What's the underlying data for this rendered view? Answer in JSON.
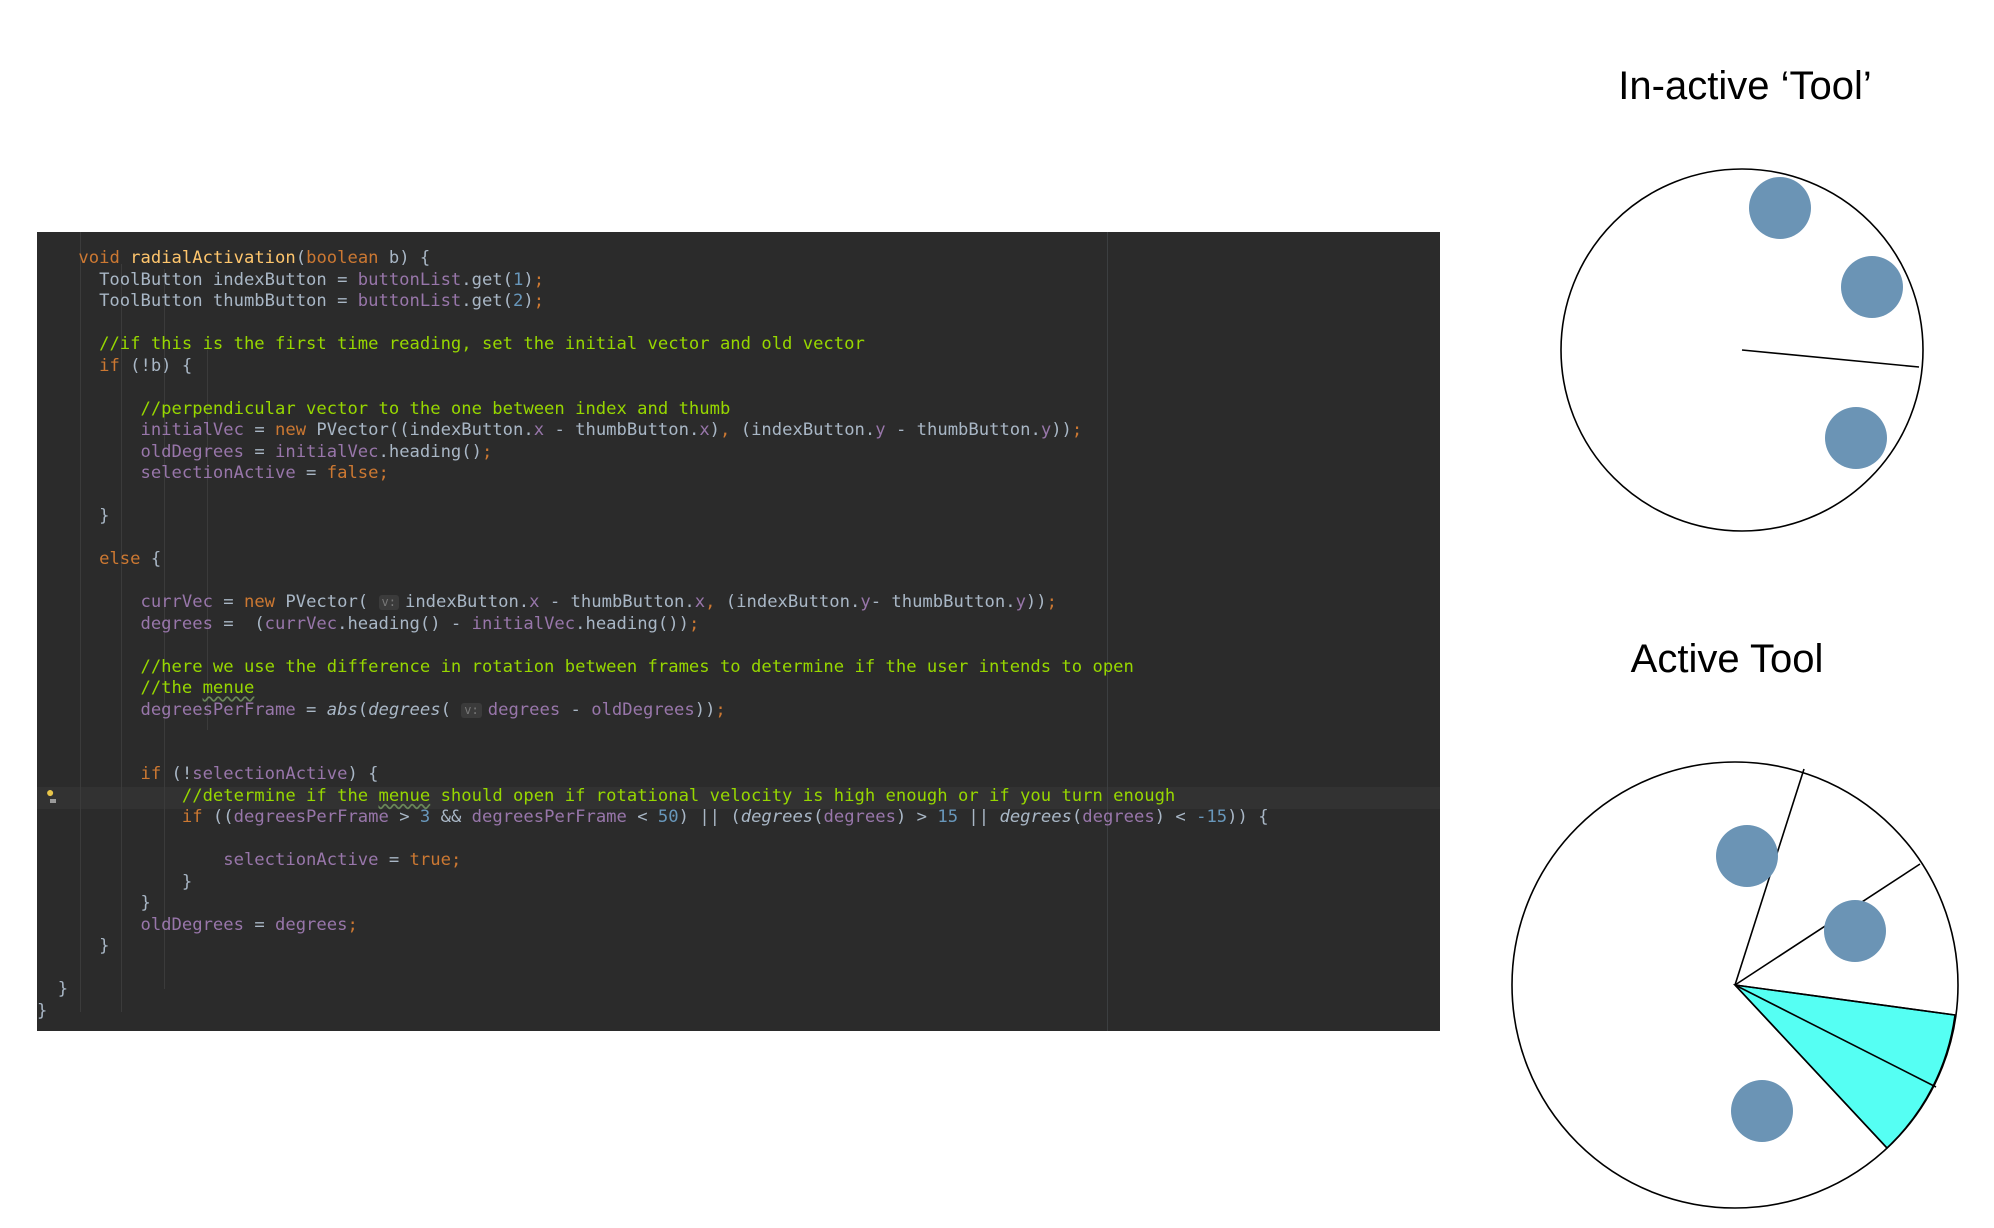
{
  "diagram": {
    "inactive_title": "In-active ‘Tool’",
    "active_title": "Active Tool"
  },
  "colors": {
    "editor_bg": "#2b2b2b",
    "button_fill": "#6b94b5",
    "active_segment": "#55fff3"
  },
  "code": {
    "lines": [
      [
        "    ",
        [
          "kw",
          "void "
        ],
        [
          "fn",
          "radialActivation"
        ],
        [
          "",
          "("
        ],
        [
          "kw",
          "boolean "
        ],
        [
          "",
          "b) {"
        ]
      ],
      [
        "      ToolButton indexButton = ",
        [
          "fld",
          "buttonList"
        ],
        [
          ".get("
        ],
        [
          "num",
          "1"
        ],
        [
          ")"
        ],
        [
          "punc",
          ";"
        ]
      ],
      [
        "      ToolButton thumbButton = ",
        [
          "fld",
          "buttonList"
        ],
        [
          ".get("
        ],
        [
          "num",
          "2"
        ],
        [
          ")"
        ],
        [
          "punc",
          ";"
        ]
      ],
      [
        ""
      ],
      [
        "      ",
        [
          "cmt",
          "//if this is the first time reading, set the initial vector and old vector"
        ]
      ],
      [
        "      ",
        [
          "kw",
          "if "
        ],
        [
          "(!b) {"
        ]
      ],
      [
        ""
      ],
      [
        "          ",
        [
          "cmt",
          "//perpendicular vector to the one between index and thumb"
        ]
      ],
      [
        "          ",
        [
          "fld",
          "initialVec"
        ],
        [
          " = "
        ],
        [
          "kw",
          "new "
        ],
        [
          "PVector((indexButton."
        ],
        [
          "fld",
          "x"
        ],
        [
          " - thumbButton."
        ],
        [
          "fld",
          "x"
        ],
        [
          ")"
        ],
        [
          "punc",
          ", "
        ],
        [
          "(indexButton."
        ],
        [
          "fld",
          "y"
        ],
        [
          " - thumbButton."
        ],
        [
          "fld",
          "y"
        ],
        [
          "))"
        ],
        [
          "punc",
          ";"
        ]
      ],
      [
        "          ",
        [
          "fld",
          "oldDegrees"
        ],
        [
          " = "
        ],
        [
          "fld",
          "initialVec"
        ],
        [
          ".heading()"
        ],
        [
          "punc",
          ";"
        ]
      ],
      [
        "          ",
        [
          "fld",
          "selectionActive"
        ],
        [
          " = "
        ],
        [
          "kw",
          "false"
        ],
        [
          "punc",
          ";"
        ]
      ],
      [
        ""
      ],
      [
        "      }"
      ],
      [
        ""
      ],
      [
        "      ",
        [
          "kw",
          "else "
        ],
        [
          "{"
        ]
      ],
      [
        ""
      ],
      [
        "          ",
        [
          "fld",
          "currVec"
        ],
        [
          " = "
        ],
        [
          "kw",
          "new "
        ],
        [
          "PVector( "
        ],
        [
          "hint",
          "v:"
        ],
        [
          "indexButton."
        ],
        [
          "fld",
          "x"
        ],
        [
          " - thumbButton."
        ],
        [
          "fld",
          "x"
        ],
        [
          "punc",
          ", "
        ],
        [
          "(indexButton."
        ],
        [
          "fld",
          "y"
        ],
        [
          "- thumbButton."
        ],
        [
          "fld",
          "y"
        ],
        [
          "))"
        ],
        [
          "punc",
          ";"
        ]
      ],
      [
        "          ",
        [
          "fld",
          "degrees"
        ],
        [
          " =  ("
        ],
        [
          "fld",
          "currVec"
        ],
        [
          ".heading() - "
        ],
        [
          "fld",
          "initialVec"
        ],
        [
          ".heading())"
        ],
        [
          "punc",
          ";"
        ]
      ],
      [
        ""
      ],
      [
        "          ",
        [
          "cmt",
          "//here we use the difference in rotation between frames to determine if the user intends to open"
        ]
      ],
      [
        "          ",
        [
          "cmt",
          "//the "
        ],
        [
          "cmtsq",
          "menue"
        ]
      ],
      [
        "          ",
        [
          "fld",
          "degreesPerFrame"
        ],
        [
          " = "
        ],
        [
          "it",
          "abs"
        ],
        [
          "("
        ],
        [
          "it",
          "degrees"
        ],
        [
          "( "
        ],
        [
          "hint",
          "v:"
        ],
        [
          "fld",
          "degrees"
        ],
        [
          " - "
        ],
        [
          "fld",
          "oldDegrees"
        ],
        [
          "))"
        ],
        [
          "punc",
          ";"
        ]
      ],
      [
        ""
      ],
      [
        ""
      ],
      [
        "          ",
        [
          "kw",
          "if "
        ],
        [
          "(!"
        ],
        [
          "fld",
          "selectionActive"
        ],
        [
          ") {"
        ]
      ],
      [
        "              ",
        [
          "cmt",
          "//determine if the "
        ],
        [
          "cmtsq",
          "menue"
        ],
        [
          "cmt",
          " should open if rotational velocity is high enough or if you turn enough"
        ]
      ],
      [
        "              ",
        [
          "kw",
          "if "
        ],
        [
          "(("
        ],
        [
          "fld",
          "degreesPerFrame"
        ],
        [
          " > "
        ],
        [
          "num",
          "3"
        ],
        [
          " && "
        ],
        [
          "fld",
          "degreesPerFrame"
        ],
        [
          " < "
        ],
        [
          "num",
          "50"
        ],
        [
          ") || ("
        ],
        [
          "it",
          "degrees"
        ],
        [
          "("
        ],
        [
          "fld",
          "degrees"
        ],
        [
          ") > "
        ],
        [
          "num",
          "15"
        ],
        [
          " || "
        ],
        [
          "it",
          "degrees"
        ],
        [
          "("
        ],
        [
          "fld",
          "degrees"
        ],
        [
          ") < "
        ],
        [
          "num",
          "-15"
        ],
        [
          ")) {"
        ]
      ],
      [
        ""
      ],
      [
        "                  ",
        [
          "fld",
          "selectionActive"
        ],
        [
          " = "
        ],
        [
          "kw",
          "true"
        ],
        [
          "punc",
          ";"
        ]
      ],
      [
        "              }"
      ],
      [
        "          }"
      ],
      [
        "          ",
        [
          "fld",
          "oldDegrees"
        ],
        [
          " = "
        ],
        [
          "fld",
          "degrees"
        ],
        [
          "punc",
          ";"
        ]
      ],
      [
        "      }"
      ],
      [
        ""
      ],
      [
        "  }"
      ],
      [
        "}"
      ]
    ]
  }
}
